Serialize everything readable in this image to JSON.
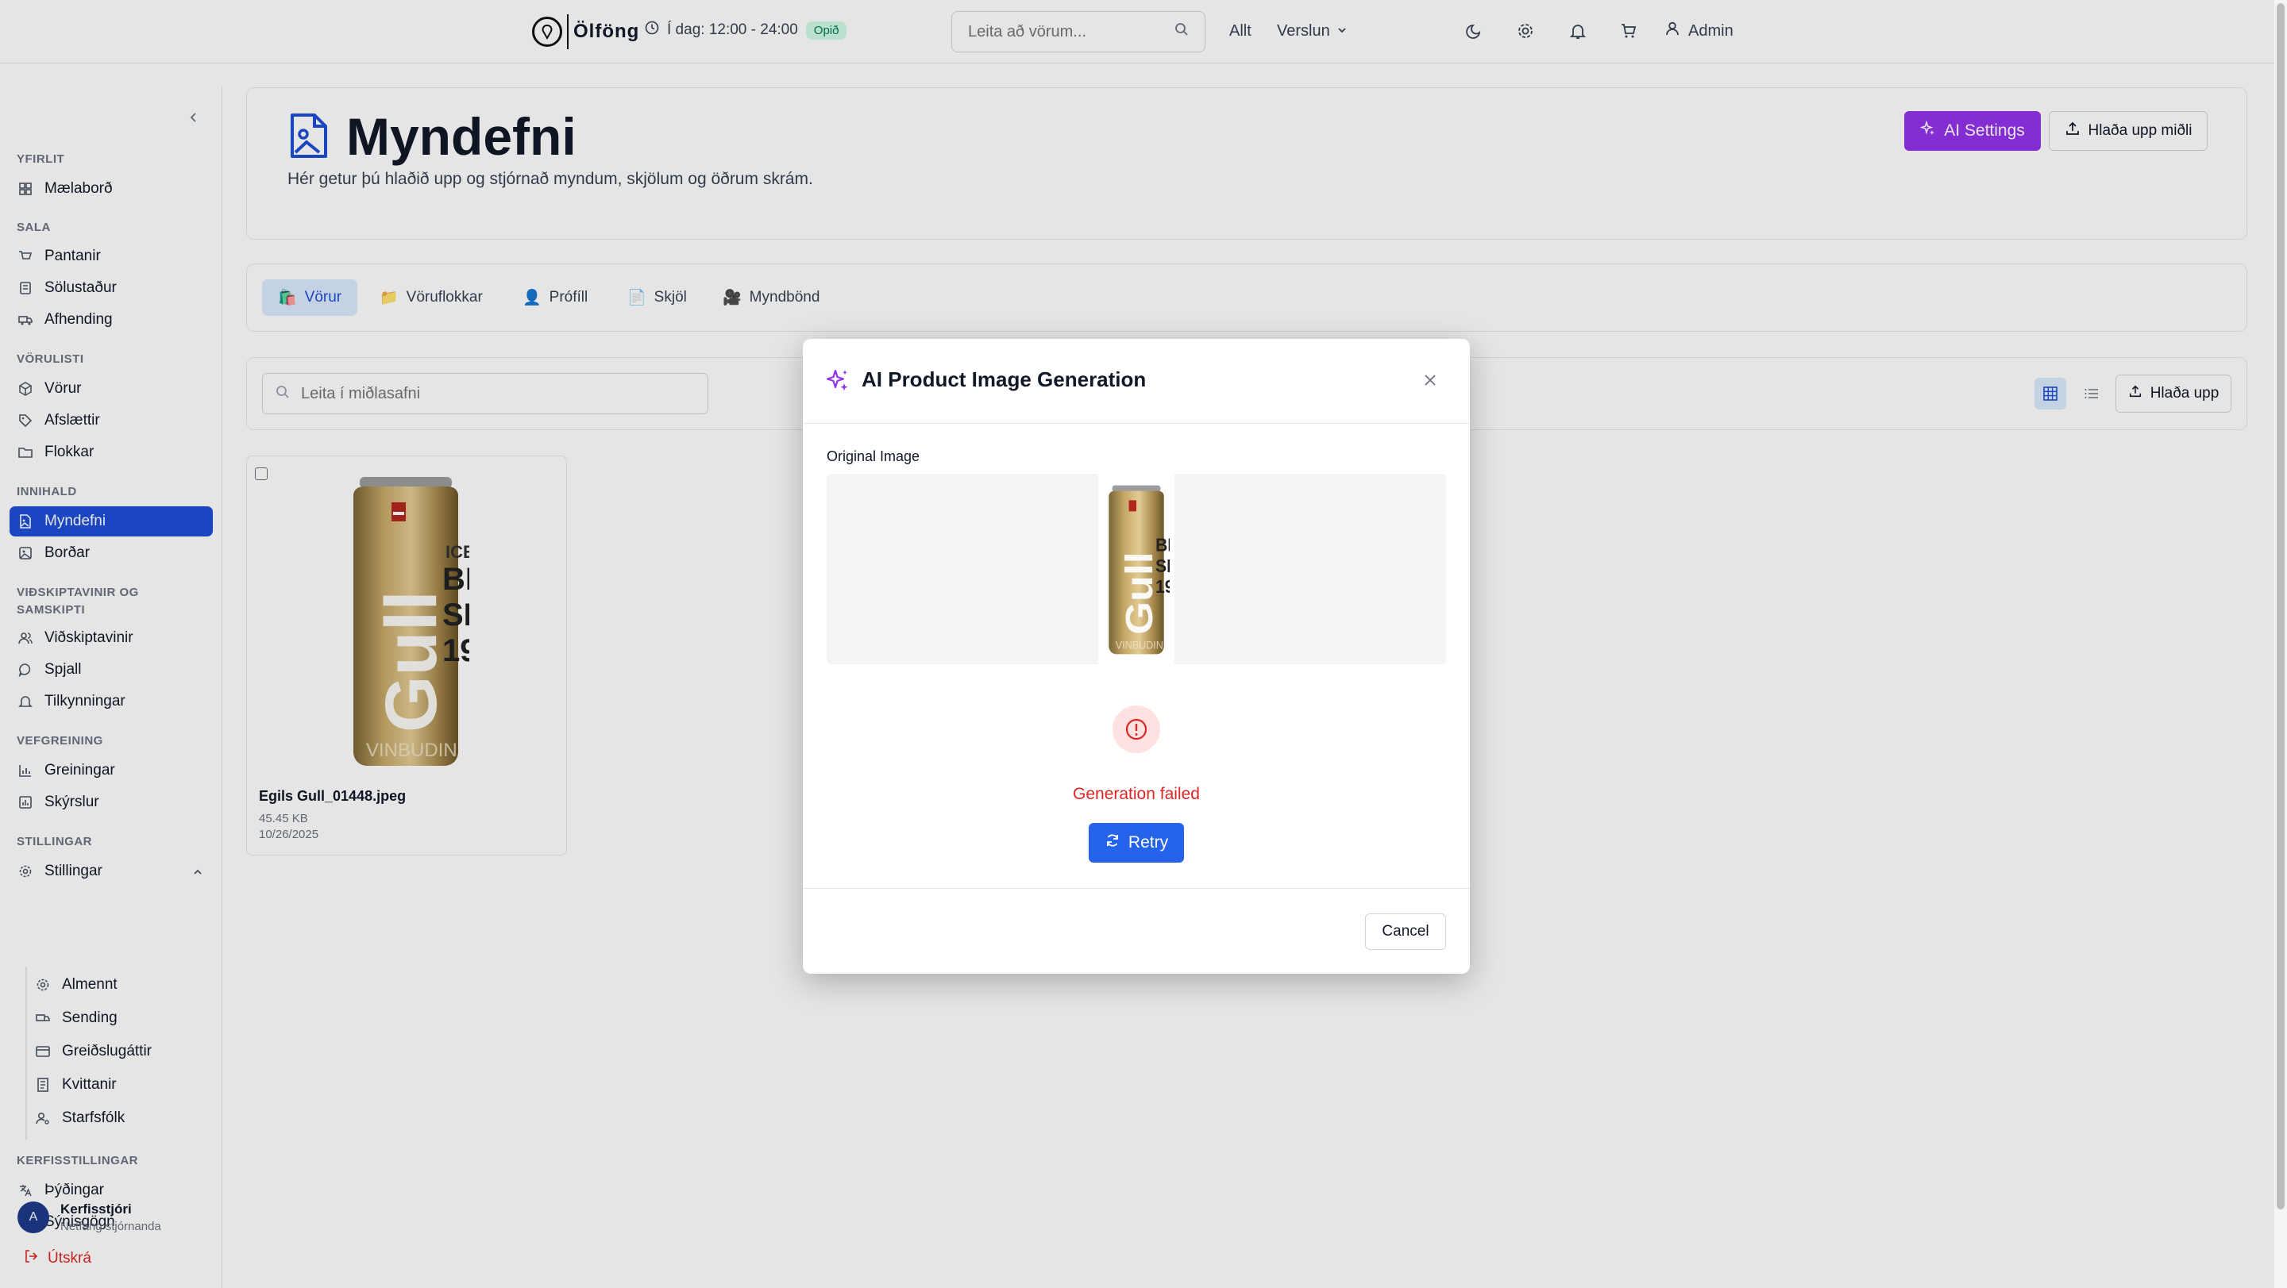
{
  "topbar": {
    "logo_text": "Ölföng",
    "hours": "Í dag: 12:00 - 24:00",
    "open_badge": "Opið",
    "search_placeholder": "Leita að vörum...",
    "filter_all": "Allt",
    "store_menu": "Verslun",
    "user_label": "Admin",
    "icons": [
      "moon-icon",
      "gear-icon",
      "bell-icon",
      "cart-icon",
      "user-icon"
    ]
  },
  "sidebar": {
    "sections": [
      {
        "title": "Yfirlit",
        "items": [
          {
            "label": "Mælaborð",
            "icon": "dashboard-icon"
          }
        ]
      },
      {
        "title": "Sala",
        "items": [
          {
            "label": "Pantanir",
            "icon": "cart-icon"
          },
          {
            "label": "Sölustaður",
            "icon": "pos-icon"
          },
          {
            "label": "Afhending",
            "icon": "truck-icon"
          }
        ]
      },
      {
        "title": "Vörulisti",
        "items": [
          {
            "label": "Vörur",
            "icon": "package-icon"
          },
          {
            "label": "Afslættir",
            "icon": "tag-icon"
          },
          {
            "label": "Flokkar",
            "icon": "folder-icon"
          }
        ]
      },
      {
        "title": "Innihald",
        "items": [
          {
            "label": "Myndefni",
            "icon": "image-icon"
          },
          {
            "label": "Borðar",
            "icon": "banner-icon"
          }
        ]
      },
      {
        "title": "Viðskiptavinir og samskipti",
        "items": [
          {
            "label": "Viðskiptavinir",
            "icon": "users-icon"
          },
          {
            "label": "Spjall",
            "icon": "chat-icon"
          },
          {
            "label": "Tilkynningar",
            "icon": "bell-icon"
          }
        ]
      },
      {
        "title": "Vefgreining",
        "items": [
          {
            "label": "Greiningar",
            "icon": "chart-icon"
          },
          {
            "label": "Skýrslur",
            "icon": "report-icon"
          }
        ]
      },
      {
        "title": "Stillingar",
        "items": [
          {
            "label": "Stillingar",
            "icon": "gear-icon"
          }
        ]
      },
      {
        "title": "Kerfisstillingar",
        "items": [
          {
            "label": "Þýðingar",
            "icon": "translate-icon"
          },
          {
            "label": "Sýnisgögn",
            "icon": "play-icon"
          }
        ]
      }
    ],
    "settings_sub": [
      {
        "label": "Almennt",
        "icon": "gear-icon"
      },
      {
        "label": "Sending",
        "icon": "truck-icon"
      },
      {
        "label": "Greiðslugáttir",
        "icon": "card-icon"
      },
      {
        "label": "Kvittanir",
        "icon": "receipt-icon"
      },
      {
        "label": "Starfsfólk",
        "icon": "user-gear-icon"
      }
    ],
    "user": {
      "initial": "A",
      "name": "Kerfisstjóri",
      "email": "Netfang stjórnanda"
    },
    "logout": "Útskrá"
  },
  "main": {
    "title": "Myndefni",
    "subtitle": "Hér getur þú hlaðið upp og stjórnað myndum, skjölum og öðrum skrám.",
    "ai_settings": "AI Settings",
    "upload_media": "Hlaða upp miðli",
    "tabs": [
      {
        "label": "Vörur",
        "emoji": "🛍️"
      },
      {
        "label": "Vöruflokkar",
        "emoji": "📁"
      },
      {
        "label": "Prófíll",
        "emoji": "👤"
      },
      {
        "label": "Skjöl",
        "emoji": "📄"
      },
      {
        "label": "Myndbönd",
        "emoji": "🎥"
      }
    ],
    "library_search_placeholder": "Leita í miðlasafni",
    "upload_small": "Hlaða upp",
    "media": [
      {
        "name": "Egils Gull_01448.jpeg",
        "size": "45.45 KB",
        "date": "10/26/2025"
      }
    ]
  },
  "modal": {
    "title": "AI Product Image Generation",
    "original_label": "Original Image",
    "error_text": "Generation failed",
    "retry": "Retry",
    "cancel": "Cancel"
  },
  "colors": {
    "primary": "#2563eb",
    "active_nav": "#1d4ed8",
    "ai_purple": "#9333ea",
    "error": "#dc2626",
    "open_green": "#047857"
  }
}
